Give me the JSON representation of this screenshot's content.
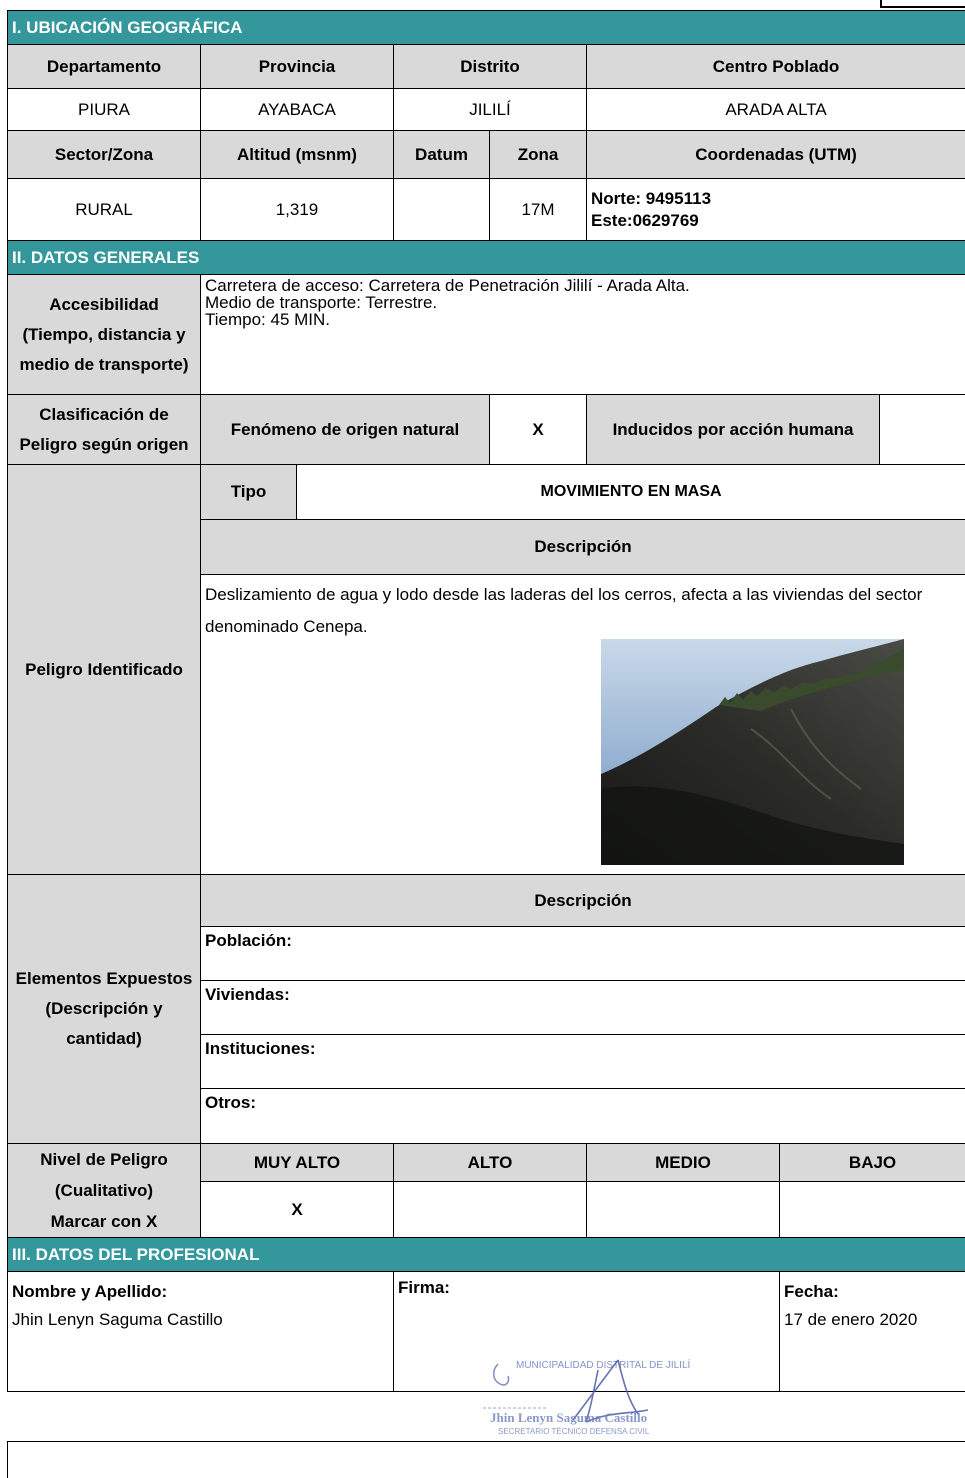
{
  "sections": {
    "ubicacion": "I. UBICACIÓN GEOGRÁFICA",
    "datos_generales": "II. DATOS GENERALES",
    "profesional": "III. DATOS DEL PROFESIONAL"
  },
  "ubicacion": {
    "headers1": [
      "Departamento",
      "Provincia",
      "Distrito",
      "Centro Poblado"
    ],
    "values1": [
      "PIURA",
      "AYABACA",
      "JILILÍ",
      "ARADA ALTA"
    ],
    "headers2": [
      "Sector/Zona",
      "Altitud (msnm)",
      "Datum",
      "Zona",
      "Coordenadas (UTM)"
    ],
    "values2": {
      "sector": "RURAL",
      "altitud": "1,319",
      "datum": "",
      "zona": "17M",
      "norte": "Norte: 9495113",
      "este": "Este:0629769"
    }
  },
  "accesibilidad": {
    "label_line1": "Accesibilidad",
    "label_line2": "(Tiempo, distancia y",
    "label_line3": "medio de transporte)",
    "line1": "Carretera de acceso: Carretera de Penetración Jililí - Arada Alta.",
    "line2": "Medio de transporte: Terrestre.",
    "line3": "Tiempo: 45 MIN."
  },
  "clasificacion": {
    "label_line1": "Clasificación de",
    "label_line2": "Peligro según origen",
    "natural": "Fenómeno de origen natural",
    "natural_mark": "X",
    "humana": "Inducidos por acción humana",
    "humana_mark": ""
  },
  "peligro": {
    "label": "Peligro Identificado",
    "tipo_label": "Tipo",
    "tipo_value": "MOVIMIENTO EN MASA",
    "descripcion_label": "Descripción",
    "descripcion": "Deslizamiento de agua y lodo desde las laderas del los cerros, afecta a las viviendas del sector denominado Cenepa."
  },
  "expuestos": {
    "label_line1": "Elementos Expuestos",
    "label_line2": "(Descripción y",
    "label_line3": "cantidad)",
    "descripcion_label": "Descripción",
    "items": [
      "Población:",
      "Viviendas:",
      "Instituciones:",
      "Otros:"
    ]
  },
  "nivel": {
    "label_line1": "Nivel de Peligro",
    "label_line2": "(Cualitativo)",
    "label_line3": "Marcar con X",
    "levels": [
      "MUY ALTO",
      "ALTO",
      "MEDIO",
      "BAJO"
    ],
    "marks": [
      "X",
      "",
      "",
      ""
    ]
  },
  "profesional": {
    "nombre_label": "Nombre y Apellido:",
    "nombre": "Jhin Lenyn Saguma Castillo",
    "firma_label": "Firma:",
    "fecha_label": "Fecha:",
    "fecha": "17 de enero 2020"
  },
  "stamp": {
    "line1": "MUNICIPALIDAD DISTRITAL DE JILILÍ",
    "line2": "Jhin Lenyn Saguma Castillo",
    "line3": "SECRETARIO TÉCNICO DEFENSA CIVIL"
  },
  "colors": {
    "section_bg": "#33979c",
    "header_bg": "#d9d9d9"
  }
}
